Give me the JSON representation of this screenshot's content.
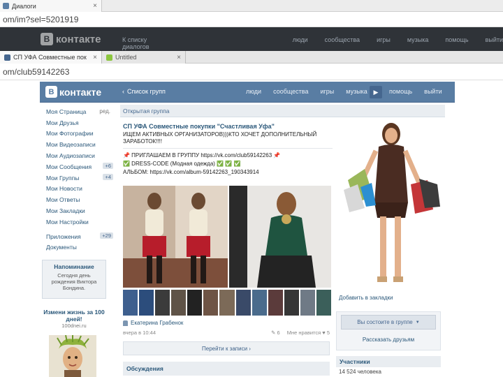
{
  "back_window": {
    "tab_title": "Диалоги",
    "url": "om/im?sel=5201919",
    "vk_logo": "контакте",
    "vk_links": [
      "К списку диалогов",
      "люди",
      "сообщества",
      "игры",
      "музыка",
      "помощь",
      "выйти"
    ]
  },
  "browser": {
    "tabs": [
      {
        "title": "СП УФА Совместные пок"
      },
      {
        "title": "Untitled"
      }
    ],
    "url": "om/club59142263"
  },
  "vk": {
    "logo_b": "B",
    "logo_text": "контакте",
    "back_link": "Список групп",
    "nav": [
      "люди",
      "сообщества",
      "игры",
      "музыка"
    ],
    "nav_right": [
      "помощь",
      "выйти"
    ],
    "arrow": "▶"
  },
  "left_menu": {
    "items": [
      {
        "label": "Моя Страница",
        "extra": "ред."
      },
      {
        "label": "Мои Друзья"
      },
      {
        "label": "Мои Фотографии"
      },
      {
        "label": "Мои Видеозаписи"
      },
      {
        "label": "Мои Аудиозаписи"
      },
      {
        "label": "Мои Сообщения",
        "count": "+6"
      },
      {
        "label": "Мои Группы",
        "count": "+4"
      },
      {
        "label": "Мои Новости"
      },
      {
        "label": "Мои Ответы"
      },
      {
        "label": "Мои Закладки"
      },
      {
        "label": "Мои Настройки"
      }
    ],
    "items2": [
      {
        "label": "Приложения",
        "count": "+29"
      },
      {
        "label": "Документы"
      }
    ],
    "reminder": {
      "title": "Напоминание",
      "text": "Сегодня день рождения Виктора Бондина."
    },
    "ad": {
      "title": "Измени жизнь за 100 дней!",
      "sub": "100dnei.ru"
    }
  },
  "group": {
    "header": "Открытая группа",
    "post": {
      "title": "СП УФА Совместные покупки \"Счастливая Уфа\"",
      "text": "ИЩЕМ АКТИВНЫХ ОРГАНИЗАТОРОВ)))КТО ХОЧЕТ ДОПОЛНИТЕЛЬНЫЙ ЗАРАБОТОК!!!!",
      "line1": "📌 ПРИГЛАШАЕМ В ГРУППУ https://vk.com/club59142263 📌",
      "line2": "✅ DRESS-CODE (Модная одежда) ✅ ✅ ✅",
      "line3": "АЛЬБОМ: https://vk.com/album-59142263_190343914",
      "author": "Екатерина Грабенок",
      "time": "вчера в 10:44",
      "like": "Мне нравится",
      "like_count": "5",
      "comments": "6"
    },
    "more_button": "Перейти к записи",
    "discussions": "Обсуждения"
  },
  "right": {
    "bookmark": "Добавить в закладки",
    "member_button": "Вы состоите в группе",
    "member_caret": "▼",
    "tell_friends": "Рассказать друзьям",
    "members_header": "Участники",
    "members_count": "14 524 человека"
  }
}
